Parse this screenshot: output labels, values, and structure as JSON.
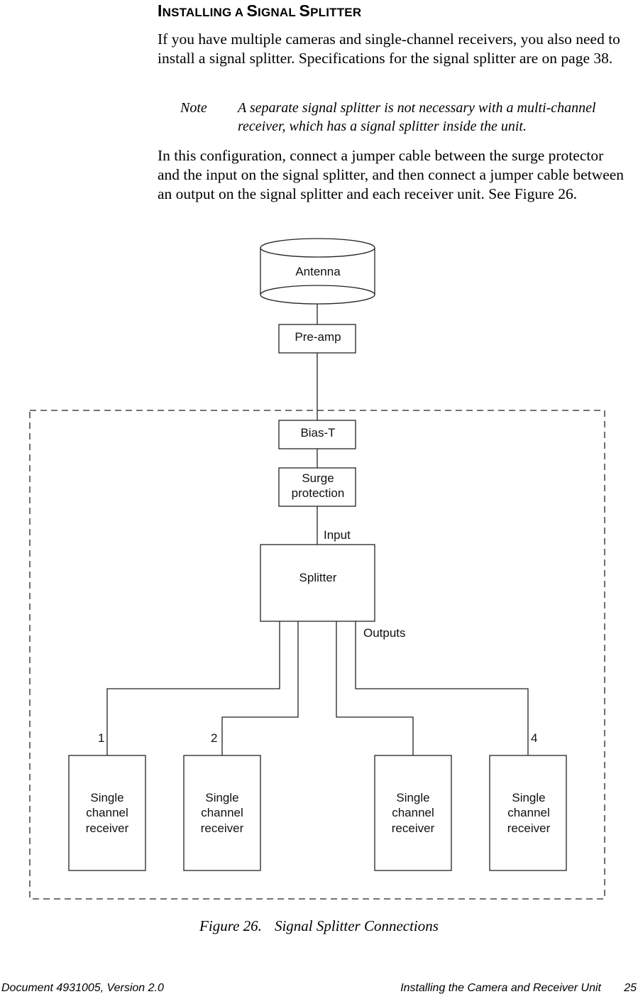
{
  "section": {
    "heading_parts": [
      {
        "text": "I",
        "big": true
      },
      {
        "text": "NSTALLING A ",
        "big": false
      },
      {
        "text": "S",
        "big": true
      },
      {
        "text": "IGNAL ",
        "big": false
      },
      {
        "text": "S",
        "big": true
      },
      {
        "text": "PLITTER",
        "big": false
      }
    ],
    "heading": "Installing a Signal Splitter",
    "paragraph1": "If you have multiple cameras and single-channel receivers, you also need to install a signal splitter. Specifications for the signal splitter are on page 38.",
    "note_label": "Note",
    "note_text": "A separate signal splitter is not necessary with a multi-channel receiver, which has a signal splitter inside the unit.",
    "paragraph2": "In this configuration, connect a jumper cable between the surge protector and the input on the signal splitter, and then connect a jumper cable between an output on the signal splitter and each receiver unit. See Figure 26."
  },
  "diagram": {
    "antenna": "Antenna",
    "preamp": "Pre-amp",
    "bias_t": "Bias-T",
    "surge_line1": "Surge",
    "surge_line2": "protection",
    "input_label": "Input",
    "splitter": "Splitter",
    "outputs_label": "Outputs",
    "receivers": [
      {
        "number": "1",
        "line1": "Single",
        "line2": "channel",
        "line3": "receiver"
      },
      {
        "number": "2",
        "line1": "Single",
        "line2": "channel",
        "line3": "receiver"
      },
      {
        "number": "",
        "line1": "Single",
        "line2": "channel",
        "line3": "receiver"
      },
      {
        "number": "4",
        "line1": "Single",
        "line2": "channel",
        "line3": "receiver"
      }
    ]
  },
  "figure": {
    "number": "Figure 26.",
    "title": "Signal Splitter Connections"
  },
  "footer": {
    "document": "Document 4931005, Version 2.0",
    "chapter": "Installing the Camera and Receiver Unit",
    "page": "25"
  }
}
